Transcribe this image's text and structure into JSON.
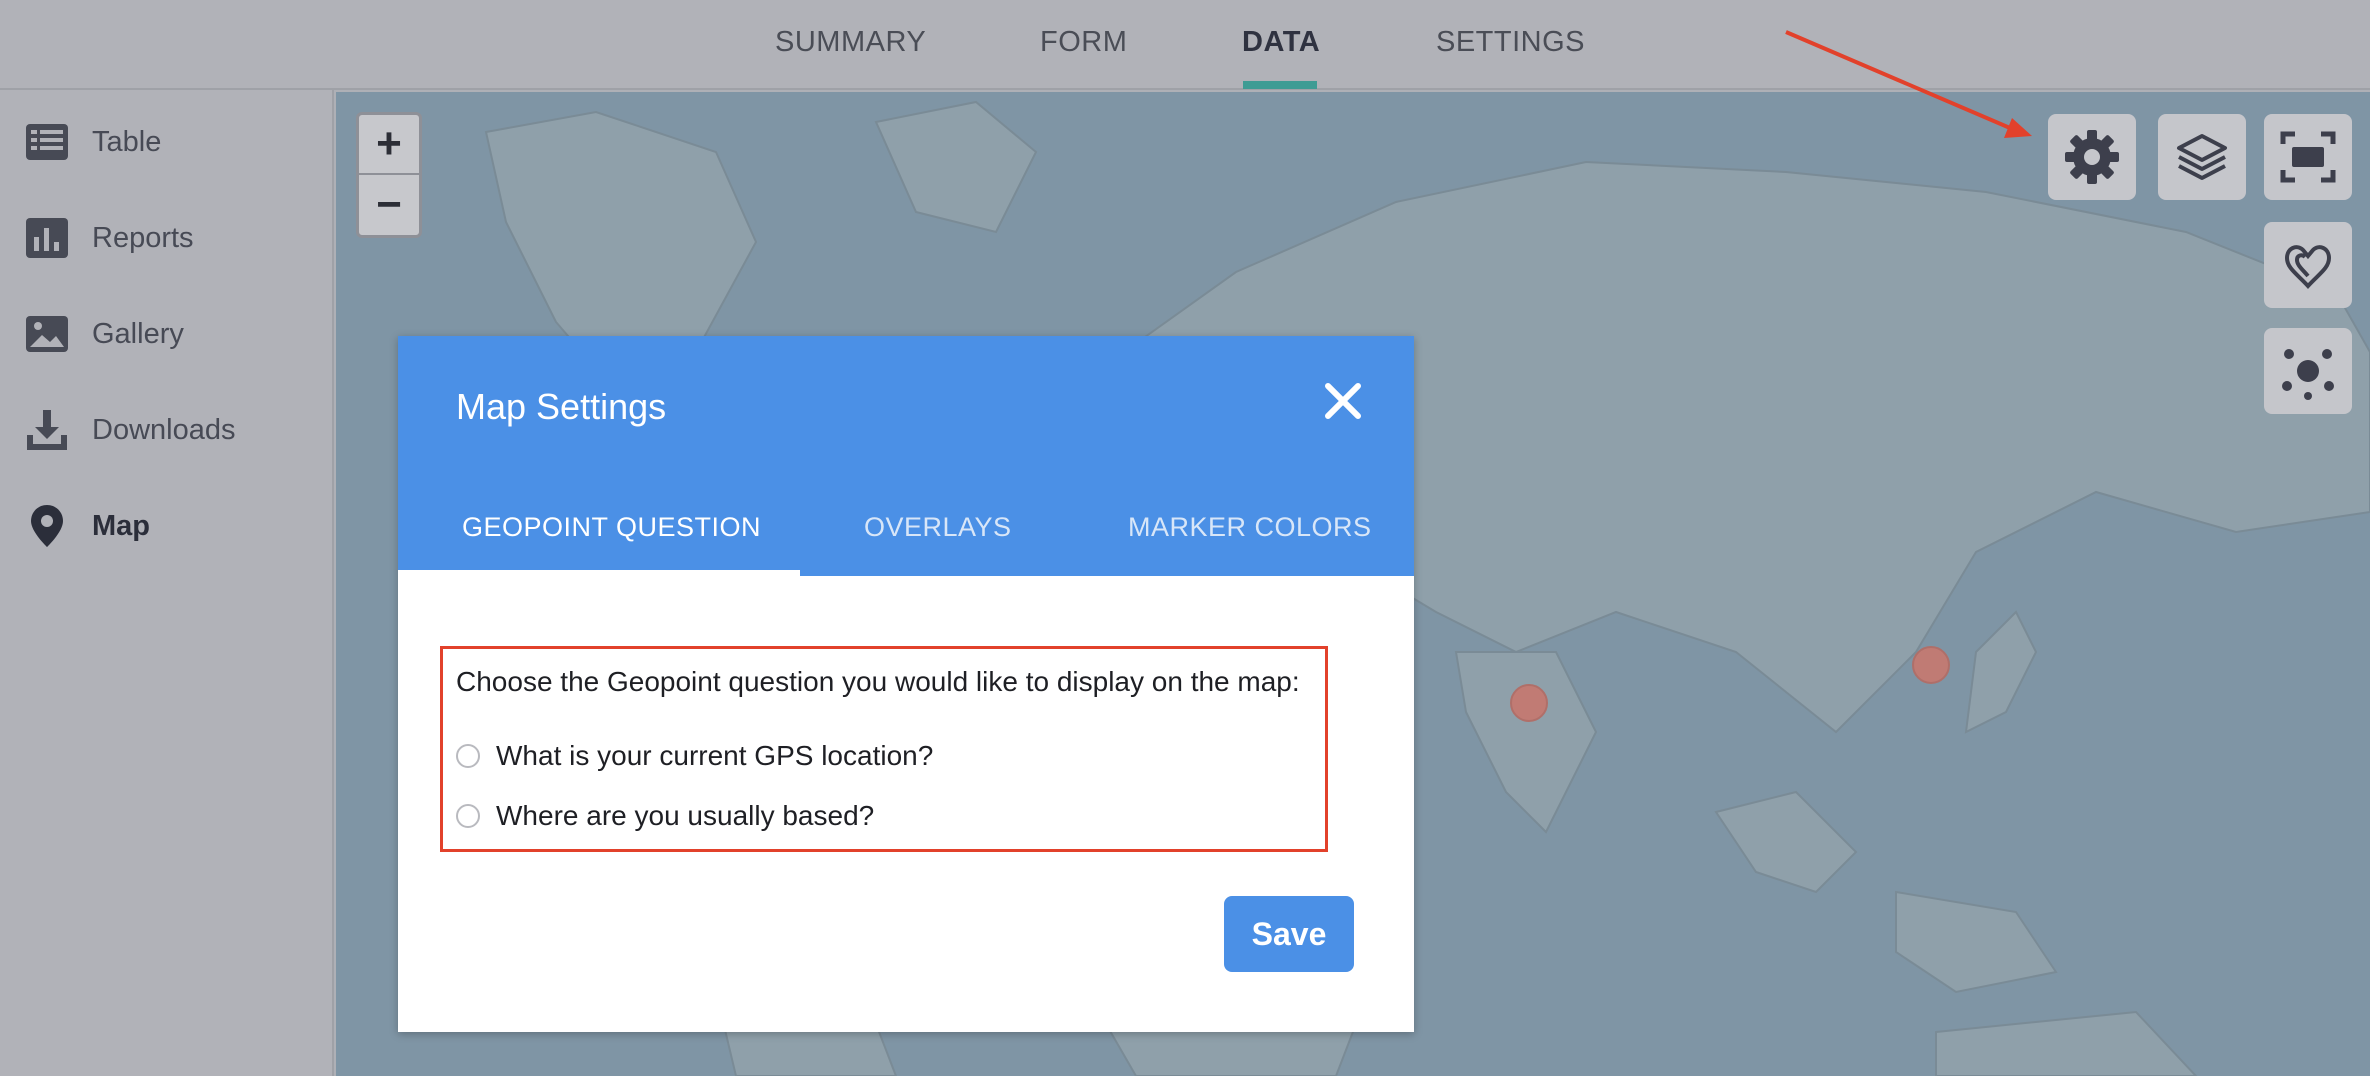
{
  "topnav": {
    "tabs": [
      {
        "label": "SUMMARY",
        "active": false
      },
      {
        "label": "FORM",
        "active": false
      },
      {
        "label": "DATA",
        "active": true
      },
      {
        "label": "SETTINGS",
        "active": false
      }
    ]
  },
  "sidebar": {
    "items": [
      {
        "label": "Table",
        "icon": "table-icon",
        "active": false
      },
      {
        "label": "Reports",
        "icon": "bar-chart-icon",
        "active": false
      },
      {
        "label": "Gallery",
        "icon": "image-icon",
        "active": false
      },
      {
        "label": "Downloads",
        "icon": "download-icon",
        "active": false
      },
      {
        "label": "Map",
        "icon": "map-pin-icon",
        "active": true
      }
    ]
  },
  "map": {
    "zoom_in": "+",
    "zoom_out": "−",
    "controls": [
      "gear-icon",
      "layers-icon",
      "fullscreen-icon",
      "heatmap-icon",
      "cluster-icon"
    ],
    "marker_color": "#c47a72"
  },
  "modal": {
    "title": "Map Settings",
    "tabs": [
      {
        "label": "GEOPOINT QUESTION",
        "active": true
      },
      {
        "label": "OVERLAYS",
        "active": false
      },
      {
        "label": "MARKER COLORS",
        "active": false
      }
    ],
    "question": "Choose the Geopoint question you would like to display on the map:",
    "options": [
      "What is your current GPS location?",
      "Where are you usually based?"
    ],
    "save_label": "Save",
    "accent_color": "#4b90e6"
  },
  "annotation_color": "#e2412b"
}
